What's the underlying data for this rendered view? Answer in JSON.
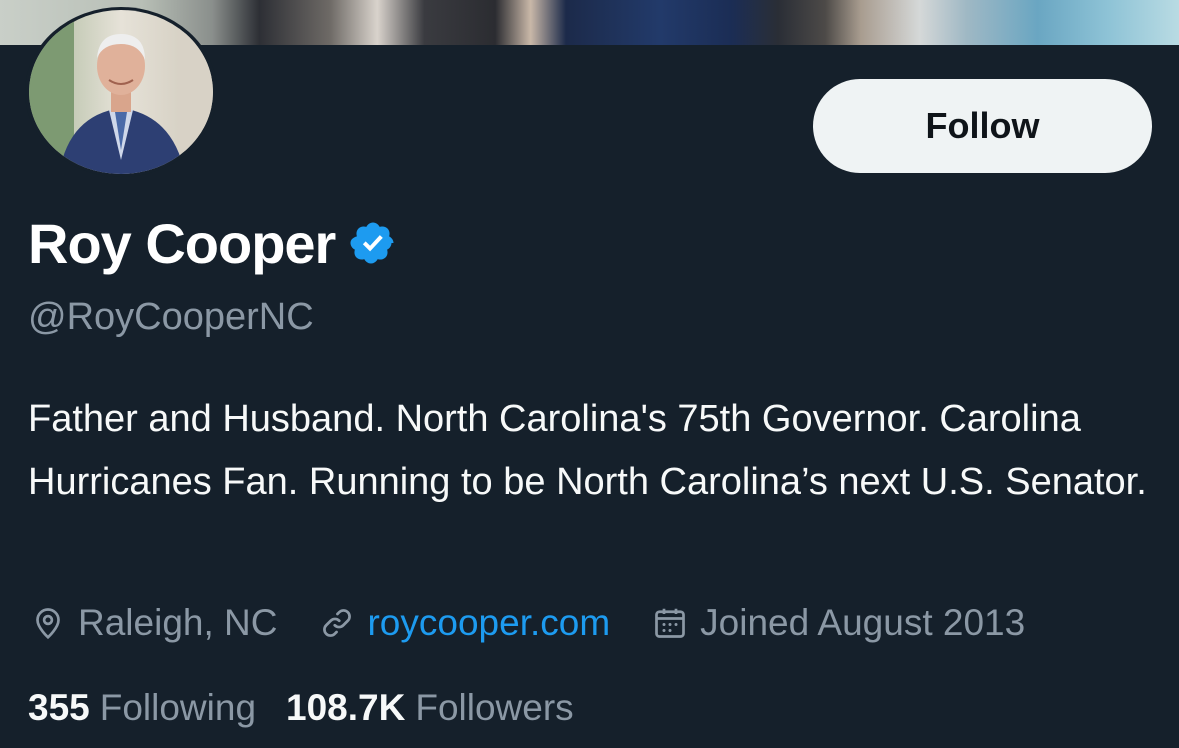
{
  "profile": {
    "name": "Roy Cooper",
    "handle": "@RoyCooperNC",
    "bio": "Father and Husband. North Carolina's 75th Governor. Carolina Hurricanes Fan. Running to be North Carolina’s next U.S. Senator.",
    "verified_icon": "verified-badge-icon",
    "location": "Raleigh, NC",
    "website": "roycooper.com",
    "joined": "Joined August 2013"
  },
  "actions": {
    "follow_label": "Follow"
  },
  "stats": {
    "following_count": "355",
    "following_label": "Following",
    "followers_count": "108.7K",
    "followers_label": "Followers"
  },
  "icons": {
    "location": "location-pin-icon",
    "link": "link-icon",
    "calendar": "calendar-icon"
  },
  "colors": {
    "background": "#15202b",
    "accent": "#1d9bf0",
    "secondary_text": "#8b98a5",
    "primary_text": "#f7f9f9",
    "button_bg": "#eff3f4"
  }
}
